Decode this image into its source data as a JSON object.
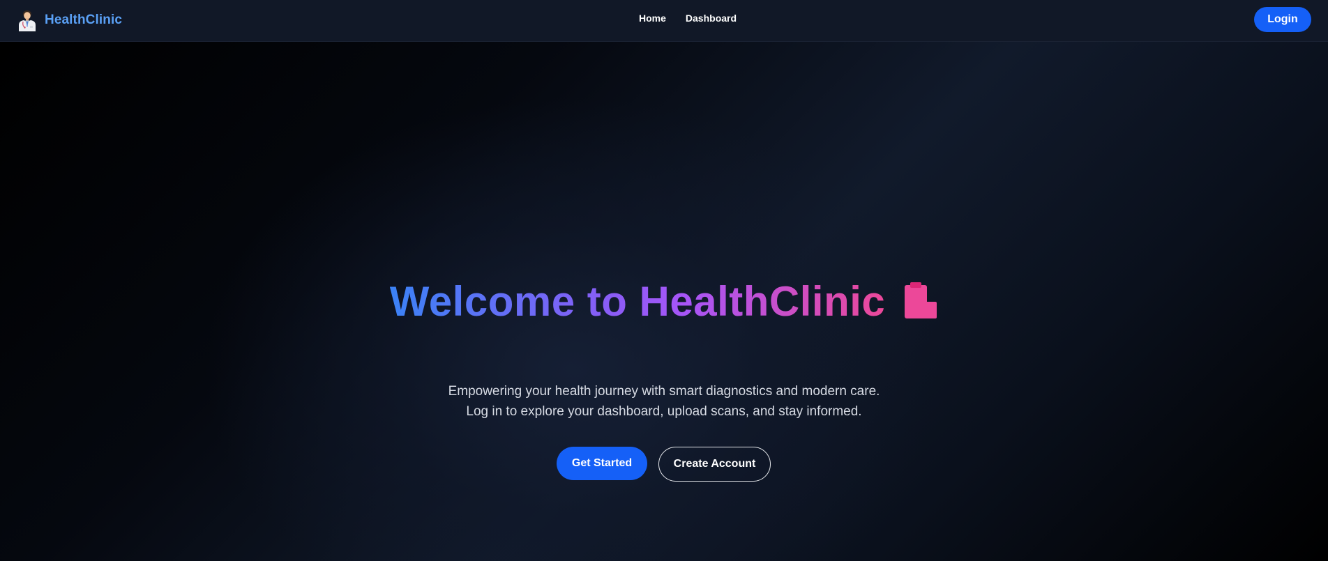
{
  "header": {
    "brand_name": "HealthClinic",
    "brand_icon": "doctor-icon",
    "nav": [
      {
        "label": "Home"
      },
      {
        "label": "Dashboard"
      }
    ],
    "login_label": "Login"
  },
  "hero": {
    "title": "Welcome to HealthClinic",
    "title_icon": "clipboard-icon",
    "subtitle_line1": "Empowering your health journey with smart diagnostics and modern care.",
    "subtitle_line2": "Log in to explore your dashboard, upload scans, and stay informed.",
    "primary_cta": "Get Started",
    "secondary_cta": "Create Account"
  },
  "colors": {
    "accent": "#1560f7",
    "brand_text": "#5aa0f5",
    "gradient_start": "#3b82f6",
    "gradient_mid": "#a855f7",
    "gradient_end": "#ec4899",
    "nav_bg": "#111827"
  }
}
